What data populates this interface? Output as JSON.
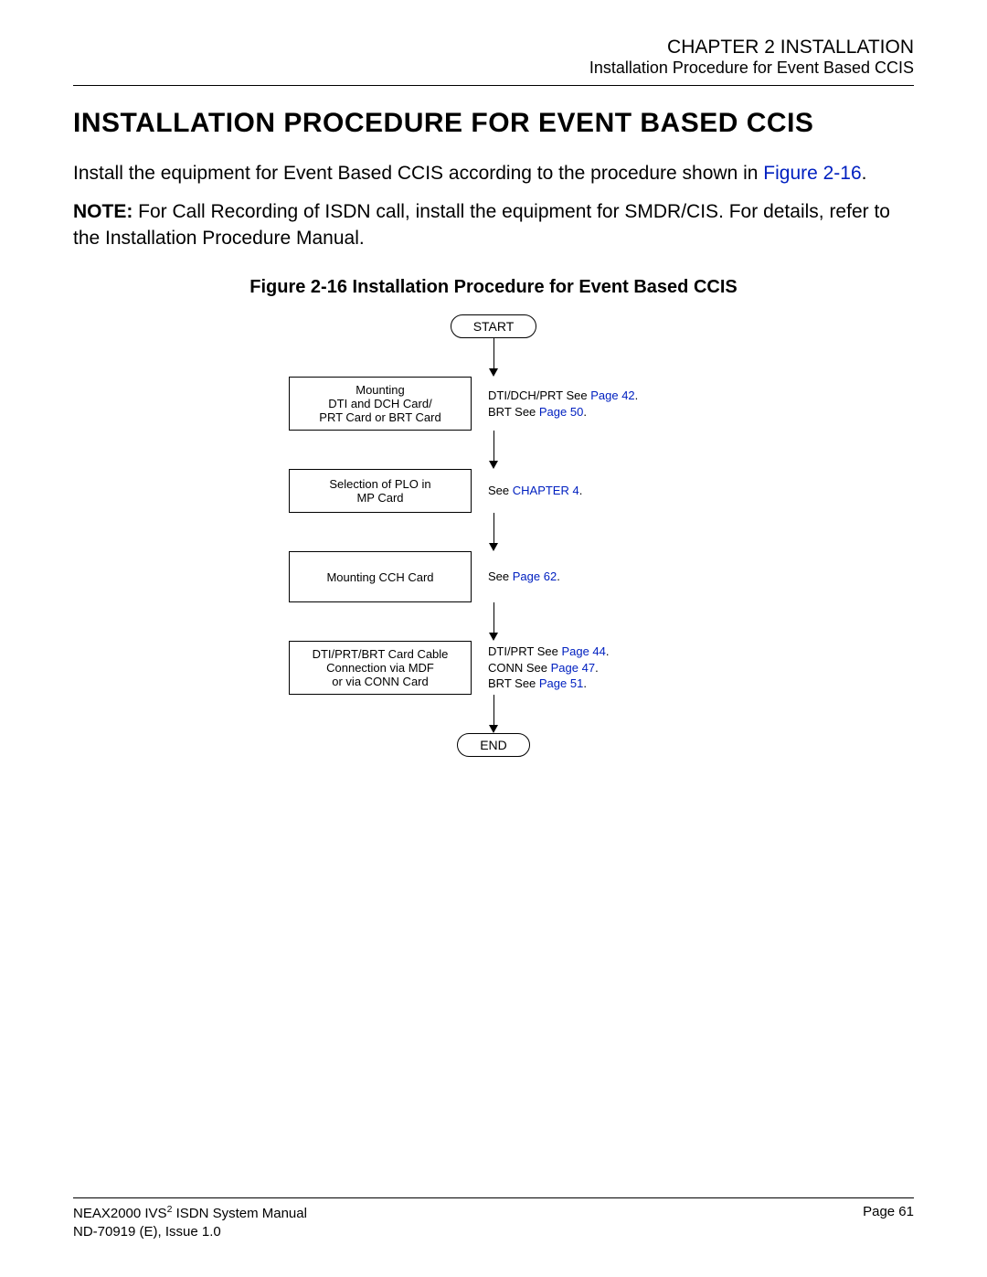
{
  "header": {
    "chapter": "CHAPTER 2  INSTALLATION",
    "subtitle": "Installation Procedure for Event Based CCIS"
  },
  "section_title": "INSTALLATION PROCEDURE FOR EVENT BASED CCIS",
  "intro": {
    "text_before_link": "Install the equipment for Event Based CCIS according to the procedure shown in ",
    "link": "Figure 2-16",
    "text_after_link": "."
  },
  "note": {
    "label": "NOTE:",
    "text": " For Call Recording of ISDN call, install the equipment for SMDR/CIS. For details, refer to the Installation Procedure Manual."
  },
  "figure_caption": "Figure 2-16  Installation Procedure for Event Based CCIS",
  "flow": {
    "start": "START",
    "step1": {
      "l1": "Mounting",
      "l2": "DTI and DCH Card/",
      "l3": "PRT Card or BRT Card",
      "side1_pre": "DTI/DCH/PRT   See ",
      "side1_link": "Page 42",
      "side1_post": ".",
      "side2_pre": "BRT   See ",
      "side2_link": "Page 50",
      "side2_post": "."
    },
    "step2": {
      "l1": "Selection of PLO in",
      "l2": "MP Card",
      "side_pre": "See ",
      "side_link": "CHAPTER 4",
      "side_post": "."
    },
    "step3": {
      "l1": "Mounting CCH Card",
      "side_pre": "See ",
      "side_link": "Page 62",
      "side_post": "."
    },
    "step4": {
      "l1": "DTI/PRT/BRT Card Cable",
      "l2": "Connection via MDF",
      "l3": "or via CONN Card",
      "side1_pre": "DTI/PRT  See ",
      "side1_link": "Page 44",
      "side1_post": ".",
      "side2_pre": "CONN  See ",
      "side2_link": "Page 47",
      "side2_post": ".",
      "side3_pre": "BRT   See ",
      "side3_link": "Page 51",
      "side3_post": "."
    },
    "end": "END"
  },
  "footer": {
    "manual_pre": "NEAX2000 IVS",
    "manual_sup": "2",
    "manual_post": " ISDN System Manual",
    "issue": "ND-70919 (E), Issue 1.0",
    "page": "Page 61"
  }
}
